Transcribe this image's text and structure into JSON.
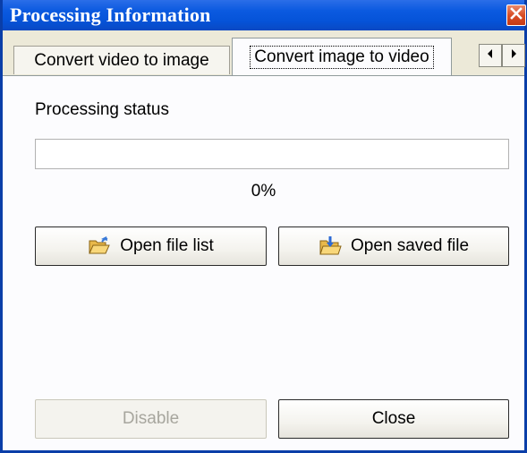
{
  "window": {
    "title": "Processing Information"
  },
  "tabs": [
    {
      "label": "Convert video to image",
      "selected": false
    },
    {
      "label": "Convert image to video",
      "selected": true
    }
  ],
  "panel": {
    "status_label": "Processing status",
    "progress_percent": 0,
    "progress_text": "0%"
  },
  "buttons": {
    "open_file_list": "Open file list",
    "open_saved_file": "Open saved file",
    "disable": "Disable",
    "close": "Close"
  },
  "icons": {
    "open_file_list": "folder-open-icon",
    "open_saved_file": "folder-download-icon",
    "close": "close-icon",
    "scroll_left": "arrow-left-icon",
    "scroll_right": "arrow-right-icon"
  },
  "colors": {
    "title_bar": "#0b5ae0",
    "close_button": "#d94e26",
    "dialog_face": "#ece9d8",
    "progress_fill": "#2fb32f"
  }
}
